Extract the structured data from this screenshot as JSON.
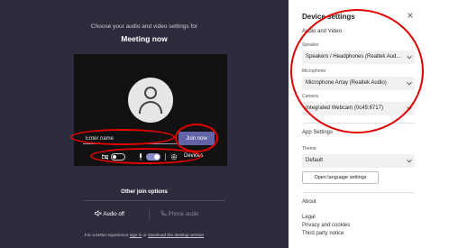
{
  "meeting": {
    "subtitle": "Choose your audio and video settings for",
    "title": "Meeting now",
    "name_placeholder": "Enter name",
    "join_label": "Join now",
    "devices_label": "Devices",
    "camera_toggle": "off",
    "mic_toggle": "on"
  },
  "other_join": {
    "title": "Other join options",
    "audio_off": "Audio off",
    "phone_audio": "Phone audio"
  },
  "footer": {
    "prefix": "For a better experience",
    "sign_in": "sign in",
    "middle": "or",
    "download": "download the desktop version"
  },
  "settings": {
    "title": "Device settings",
    "audio_video_header": "Audio and Video",
    "speaker_label": "Speaker",
    "speaker_value": "Speakers / Headphones (Realtek Aud...",
    "microphone_label": "Microphone",
    "microphone_value": "Microphone Array (Realtek Audio)",
    "camera_label": "Camera",
    "camera_value": "Integrated Webcam (0c45:6717)",
    "app_settings_header": "App Settings",
    "theme_label": "Theme",
    "theme_value": "Default",
    "language_button": "Open language settings",
    "about_header": "About",
    "legal": "Legal",
    "privacy": "Privacy and cookies",
    "third_party": "Third party notice"
  },
  "colors": {
    "left_bg": "#2d2c3d",
    "accent": "#6264a7",
    "annotation": "#e00000"
  }
}
